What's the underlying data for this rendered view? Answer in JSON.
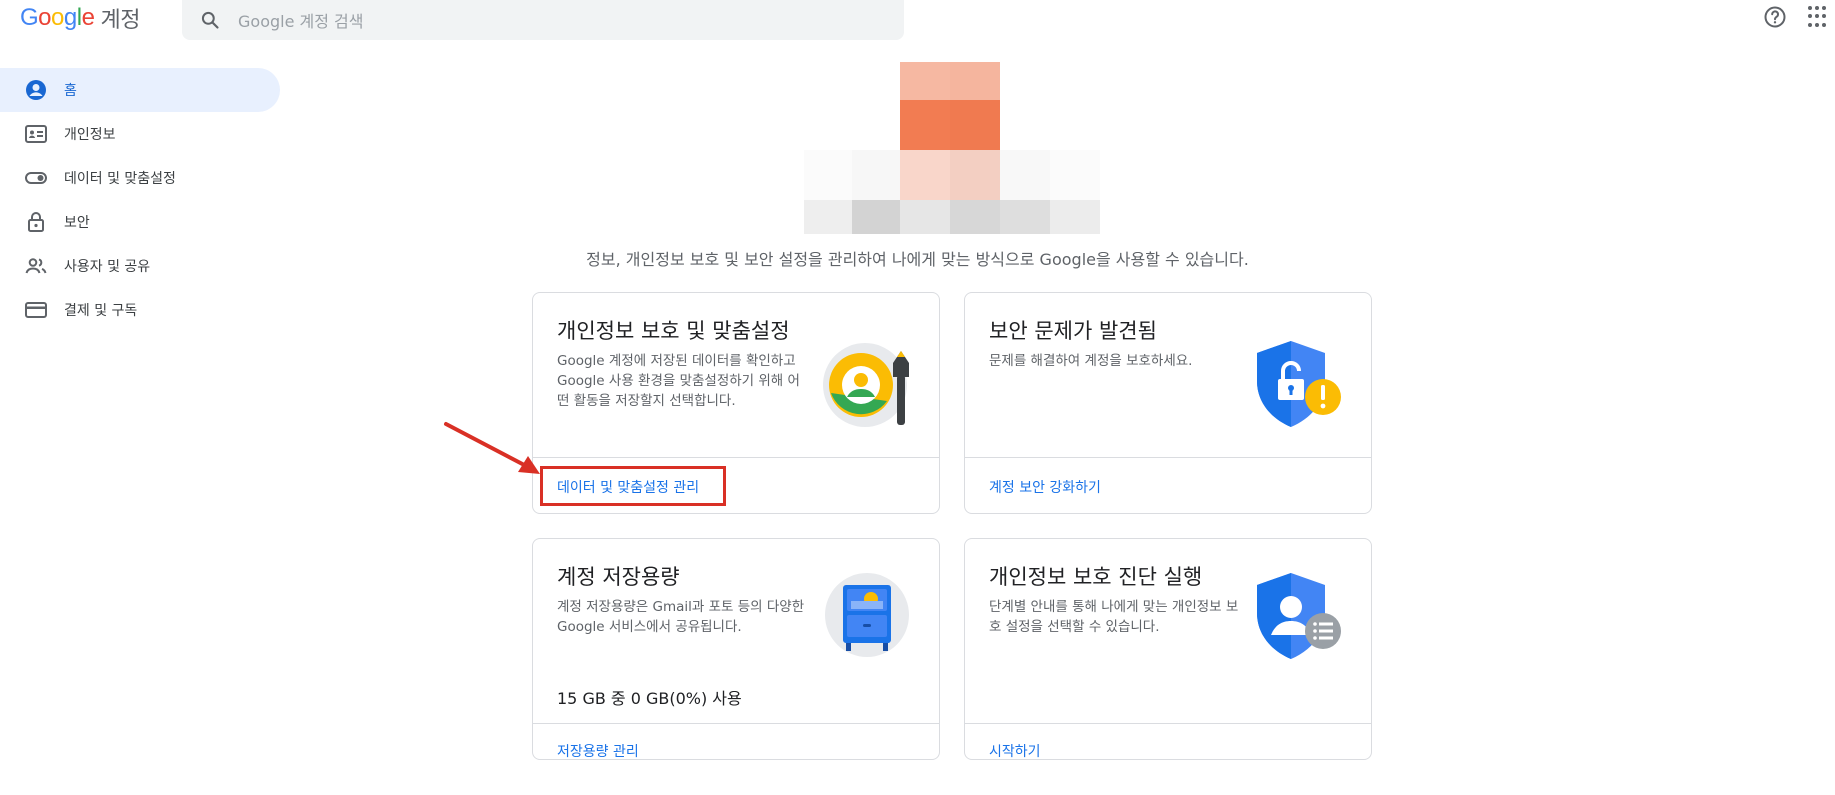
{
  "header": {
    "logo": {
      "G": "G",
      "o1": "o",
      "o2": "o",
      "g": "g",
      "l": "l",
      "e": "e",
      "product": "계정"
    },
    "search_placeholder": "Google 계정 검색"
  },
  "nav": [
    {
      "label": "홈",
      "icon": "account-circle-icon",
      "active": true
    },
    {
      "label": "개인정보",
      "icon": "id-card-icon"
    },
    {
      "label": "데이터 및 맞춤설정",
      "icon": "toggle-icon"
    },
    {
      "label": "보안",
      "icon": "lock-icon"
    },
    {
      "label": "사용자 및 공유",
      "icon": "people-icon"
    },
    {
      "label": "결제 및 구독",
      "icon": "credit-card-icon"
    }
  ],
  "tagline": "정보, 개인정보 보호 및 보안 설정을 관리하여 나에게 맞는 방식으로 Google을 사용할 수 있습니다.",
  "cards": [
    {
      "title": "개인정보 보호 및 맞춤설정",
      "desc": "Google 계정에 저장된 데이터를 확인하고 Google 사용 환경을 맞춤설정하기 위해 어떤 활동을 저장할지 선택합니다.",
      "link": "데이터 및 맞춤설정 관리",
      "illustration": "privacy-personalization-icon"
    },
    {
      "title": "보안 문제가 발견됨",
      "desc": "문제를 해결하여 계정을 보호하세요.",
      "link": "계정 보안 강화하기",
      "illustration": "security-alert-shield-icon"
    },
    {
      "title": "계정 저장용량",
      "desc": "계정 저장용량은 Gmail과 포토 등의 다양한 Google 서비스에서 공유됩니다.",
      "usage": "15 GB 중 0 GB(0%) 사용",
      "link": "저장용량 관리",
      "illustration": "storage-cabinet-icon"
    },
    {
      "title": "개인정보 보호 진단 실행",
      "desc": "단계별 안내를 통해 나에게 맞는 개인정보 보호 설정을 선택할 수 있습니다.",
      "link": "시작하기",
      "illustration": "privacy-checkup-shield-icon"
    }
  ],
  "colors": {
    "accent": "#1a73e8",
    "active_bg": "#e8f0fe",
    "highlight": "#d93025"
  }
}
